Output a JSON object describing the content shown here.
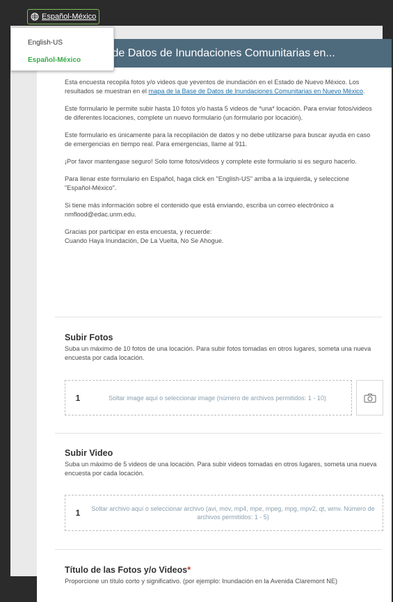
{
  "language_toggle": {
    "label": "Español-México"
  },
  "language_menu": {
    "options": [
      "English-US",
      "Español-México"
    ],
    "selected": "Español-México"
  },
  "header": {
    "title": "ara Base de Datos de Inundaciones Comunitarias en..."
  },
  "intro": {
    "p1_pre": "Esta encuesta recopila fotos y/o videos que yeventos de inundación en el Estado de Nuevo México. Los resultados se muestran en el ",
    "p1_link": "mapa de la Base de Datos de Inundaciones Comunitarias en Nuevo México",
    "p1_post": ".",
    "p2": "Este formulario le permite subir hasta 10 fotos y/o hasta 5 videos de *una* locación. Para enviar fotos/videos de diferentes locaciones, complete un nuevo formulario (un formulario por locación).",
    "p3": "Este formulario es únicamente para la recopilación de datos y no debe utilizarse para buscar ayuda en caso de emergencias en tiempo real. Para emergencias, llame al 911.",
    "p4": "¡Por favor mantengase seguro! Solo tome fotos/videos y complete este formulario si es seguro hacerlo.",
    "p5": "Para llenar este formulario en Español, haga click en \"English-US\" arriba a la izquierda, y seleccione \"Español-México\".",
    "p6": "Si tiene más información sobre el contenido que está enviando, escriba un correo electrónico a nmflood@edac.unm.edu.",
    "p7_line1": "Gracias por participar en esta encuesta, y recuerde:",
    "p7_line2": "Cuando Haya Inundación, De La Vuelta, No Se Ahogue."
  },
  "photos": {
    "title": "Subir Fotos",
    "description": "Suba un máximo de 10 fotos de una locación. Para subir fotos tomadas en otros lugares, someta una nueva encuesta por cada locación.",
    "dropzone_number": "1",
    "dropzone_text": "Soltar image aquí o seleccionar image (número de archivos permitidos: 1 - 10)"
  },
  "videos": {
    "title": "Subir Video",
    "description": "Suba un máximo de 5 videos de una locación. Para subir videos tomadas en otros lugares, someta una nueva encuesta por cada locación.",
    "dropzone_number": "1",
    "dropzone_text": "Soltar archivo aquí o seleccionar archivo (avi, mov, mp4, mpe, mpeg, mpg, mpv2, qt, wmv. Número de archivos permitidos: 1 - 5)"
  },
  "title_field": {
    "label": "Título de las Fotos y/o Videos",
    "required_mark": "*",
    "description": "Proporcione un título corto y significativo. (por ejemplo: Inundación en la Avenida Claremont NE)"
  },
  "colors": {
    "header_bg": "#4e6a7d",
    "link": "#1a6fa8",
    "selected_option": "#35ac46",
    "toggle_border": "#7fbf5a"
  }
}
